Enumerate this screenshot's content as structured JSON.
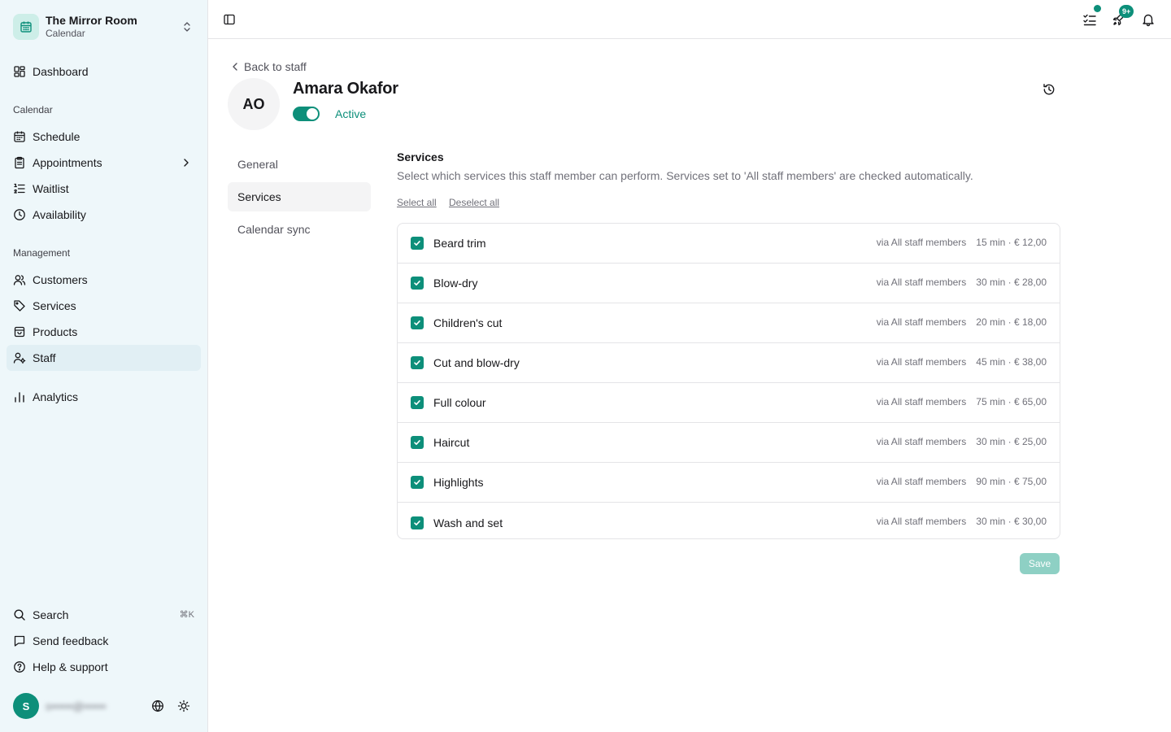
{
  "org": {
    "name": "The Mirror Room",
    "subtitle": "Calendar"
  },
  "sidebar": {
    "dashboard": "Dashboard",
    "calendar_section": "Calendar",
    "calendar_items": [
      "Schedule",
      "Appointments",
      "Waitlist",
      "Availability"
    ],
    "management_section": "Management",
    "management_items": [
      "Customers",
      "Services",
      "Products",
      "Staff"
    ],
    "analytics": "Analytics",
    "footer_items": [
      "Search",
      "Send feedback",
      "Help & support"
    ],
    "search_shortcut": "⌘K",
    "active_item": "Staff"
  },
  "user": {
    "initial": "S",
    "email": "s••••••@••••••"
  },
  "topbar": {
    "notifications_badge": "9+"
  },
  "staff": {
    "back_label": "Back to staff",
    "initials": "AO",
    "name": "Amara Okafor",
    "status": "Active",
    "active": true
  },
  "tabs": [
    "General",
    "Services",
    "Calendar sync"
  ],
  "active_tab": "Services",
  "services_section": {
    "title": "Services",
    "description": "Select which services this staff member can perform. Services set to 'All staff members' are checked automatically.",
    "select_all": "Select all",
    "deselect_all": "Deselect all",
    "items": [
      {
        "name": "Beard trim",
        "via": "via All staff members",
        "detail": "15 min · € 12,00",
        "checked": true
      },
      {
        "name": "Blow-dry",
        "via": "via All staff members",
        "detail": "30 min · € 28,00",
        "checked": true
      },
      {
        "name": "Children's cut",
        "via": "via All staff members",
        "detail": "20 min · € 18,00",
        "checked": true
      },
      {
        "name": "Cut and blow-dry",
        "via": "via All staff members",
        "detail": "45 min · € 38,00",
        "checked": true
      },
      {
        "name": "Full colour",
        "via": "via All staff members",
        "detail": "75 min · € 65,00",
        "checked": true
      },
      {
        "name": "Haircut",
        "via": "via All staff members",
        "detail": "30 min · € 25,00",
        "checked": true
      },
      {
        "name": "Highlights",
        "via": "via All staff members",
        "detail": "90 min · € 75,00",
        "checked": true
      },
      {
        "name": "Wash and set",
        "via": "via All staff members",
        "detail": "30 min · € 30,00",
        "checked": true
      }
    ],
    "save_label": "Save"
  },
  "colors": {
    "accent": "#0d8f7a",
    "sidebar_bg": "#eef7fa",
    "save_disabled": "#8ed0c4"
  }
}
